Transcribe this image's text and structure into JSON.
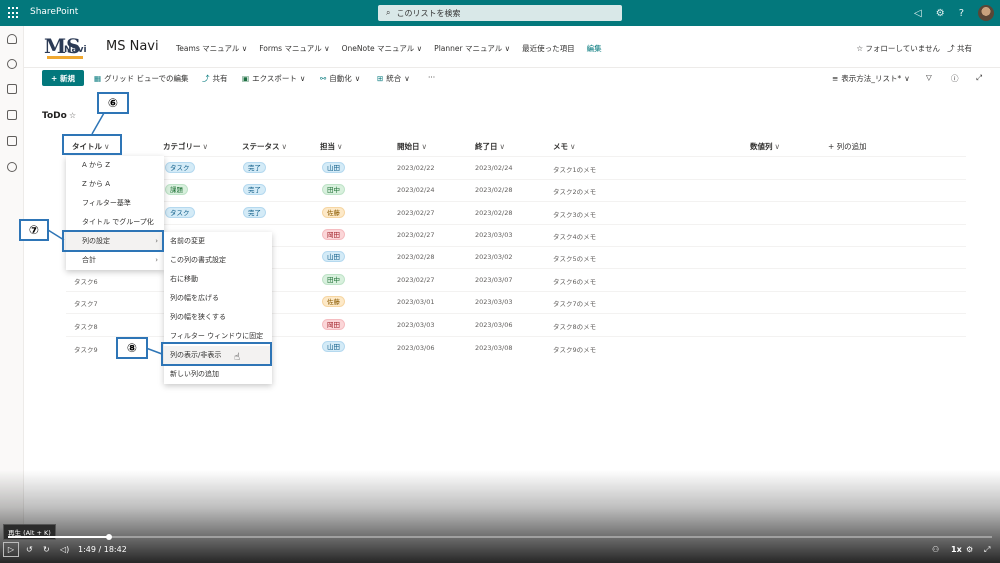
{
  "app": {
    "name": "SharePoint"
  },
  "search": {
    "placeholder": "このリストを検索"
  },
  "site": {
    "logo_ms": "MS",
    "logo_navi": "Navi",
    "name": "MS Navi",
    "nav": [
      "Teams マニュアル ∨",
      "Forms マニュアル ∨",
      "OneNote マニュアル ∨",
      "Planner マニュアル ∨",
      "最近使った項目",
      "編集"
    ],
    "follow": "☆ フォローしていません",
    "share": "⤴ 共有"
  },
  "commands": {
    "new": "+ 新規",
    "grid_edit": "グリッド ビューでの編集",
    "share": "共有",
    "export": "エクスポート",
    "automate": "自動化",
    "integrate": "統合",
    "more": "···",
    "view_options": "表示方法_リスト*"
  },
  "list": {
    "title": "ToDo"
  },
  "columns": {
    "title": "タイトル",
    "category": "カテゴリー",
    "status": "ステータス",
    "assignee": "担当",
    "start": "開始日",
    "end": "終了日",
    "memo": "メモ",
    "number": "数値列",
    "add_column": "+ 列の追加"
  },
  "rows": [
    {
      "title": "",
      "category": "タスク",
      "status": "完了",
      "assignee": "山田",
      "start": "2023/02/22",
      "end": "2023/02/24",
      "memo": "タスク1のメモ"
    },
    {
      "title": "",
      "category": "課題",
      "status": "完了",
      "assignee": "田中",
      "start": "2023/02/24",
      "end": "2023/02/28",
      "memo": "タスク2のメモ"
    },
    {
      "title": "",
      "category": "タスク",
      "status": "完了",
      "assignee": "佐藤",
      "start": "2023/02/27",
      "end": "2023/02/28",
      "memo": "タスク3のメモ"
    },
    {
      "title": "",
      "category": "",
      "status": "",
      "assignee": "岡田",
      "start": "2023/02/27",
      "end": "2023/03/03",
      "memo": "タスク4のメモ"
    },
    {
      "title": "",
      "category": "",
      "status": "",
      "assignee": "山田",
      "start": "2023/02/28",
      "end": "2023/03/02",
      "memo": "タスク5のメモ"
    },
    {
      "title": "タスク6",
      "category": "",
      "status": "",
      "assignee": "田中",
      "start": "2023/02/27",
      "end": "2023/03/07",
      "memo": "タスク6のメモ"
    },
    {
      "title": "タスク7",
      "category": "",
      "status": "",
      "assignee": "佐藤",
      "start": "2023/03/01",
      "end": "2023/03/03",
      "memo": "タスク7のメモ"
    },
    {
      "title": "タスク8",
      "category": "",
      "status": "",
      "assignee": "岡田",
      "start": "2023/03/03",
      "end": "2023/03/06",
      "memo": "タスク8のメモ"
    },
    {
      "title": "タスク9",
      "category": "",
      "status": "",
      "assignee": "山田",
      "start": "2023/03/06",
      "end": "2023/03/08",
      "memo": "タスク9のメモ"
    }
  ],
  "title_menu": [
    "A から Z",
    "Z から A",
    "フィルター基準",
    "タイトル でグループ化",
    "列の設定",
    "合計"
  ],
  "settings_submenu": [
    "名前の変更",
    "この列の書式設定",
    "右に移動",
    "列の幅を広げる",
    "列の幅を狭くする",
    "フィルター ウィンドウに固定",
    "列の表示/非表示",
    "新しい列の追加"
  ],
  "callouts": {
    "six": "⑥",
    "seven": "⑦",
    "eight": "⑧"
  },
  "player": {
    "tooltip": "再生 (Alt + K)",
    "time": "1:49 / 18:42",
    "speed": "1x",
    "progress": 0.103
  },
  "colors": {
    "accent": "#03787c",
    "callout": "#2e75b6"
  }
}
